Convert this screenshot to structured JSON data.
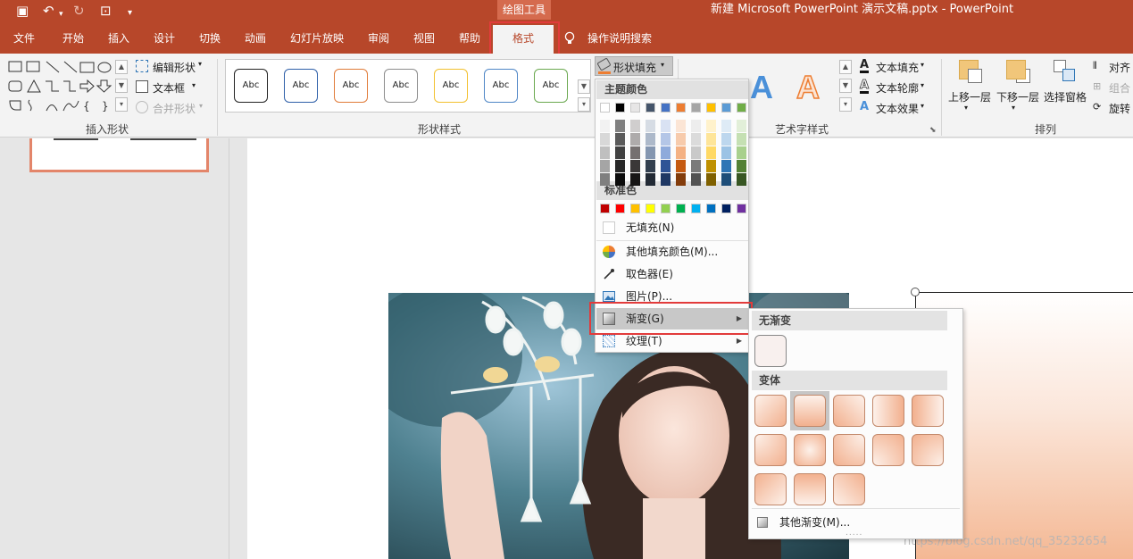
{
  "title_bar": {
    "context_tab_group": "绘图工具",
    "document_title": "新建 Microsoft PowerPoint 演示文稿.pptx  -  PowerPoint"
  },
  "tabs": [
    "文件",
    "开始",
    "插入",
    "设计",
    "切换",
    "动画",
    "幻灯片放映",
    "审阅",
    "视图",
    "帮助"
  ],
  "active_tab": "格式",
  "tell_me": "操作说明搜索",
  "ribbon": {
    "insert_shapes": {
      "label": "插入形状",
      "edit_shape": "编辑形状",
      "text_box": "文本框",
      "merge_shapes": "合并形状"
    },
    "shape_styles": {
      "label": "形状样式",
      "preset_text": "Abc",
      "shape_fill": "形状填充"
    },
    "wordart_styles": {
      "label": "艺术字样式",
      "text_fill": "文本填充",
      "text_outline": "文本轮廓",
      "text_effects": "文本效果",
      "letter": "A"
    },
    "arrange": {
      "label": "排列",
      "bring_forward": "上移一层",
      "send_backward": "下移一层",
      "selection_pane": "选择窗格",
      "align": "对齐",
      "group": "组合",
      "rotate": "旋转"
    }
  },
  "fill_menu": {
    "theme_colors_header": "主题颜色",
    "standard_colors_header": "标准色",
    "no_fill": "无填充(N)",
    "more_fill_colors": "其他填充颜色(M)...",
    "eyedropper": "取色器(E)",
    "picture": "图片(P)...",
    "gradient": "渐变(G)",
    "texture": "纹理(T)",
    "theme_top_row": [
      "#ffffff",
      "#000000",
      "#e7e6e6",
      "#44546a",
      "#4472c4",
      "#ed7d31",
      "#a5a5a5",
      "#ffc000",
      "#5b9bd5",
      "#70ad47"
    ],
    "theme_shades": [
      [
        "#f2f2f2",
        "#7f7f7f",
        "#d0cece",
        "#d6dce4",
        "#d9e2f3",
        "#fbe5d5",
        "#ededed",
        "#fff2cc",
        "#deebf6",
        "#e2efd9"
      ],
      [
        "#d8d8d8",
        "#595959",
        "#aeabab",
        "#adb9ca",
        "#b4c6e7",
        "#f7cbac",
        "#dbdbdb",
        "#fee599",
        "#bdd7ee",
        "#c5e0b3"
      ],
      [
        "#bfbfbf",
        "#3f3f3f",
        "#757070",
        "#8496b0",
        "#8eaadb",
        "#f4b183",
        "#c9c9c9",
        "#ffd965",
        "#9cc3e5",
        "#a8d08d"
      ],
      [
        "#a5a5a5",
        "#262626",
        "#3a3838",
        "#323f4f",
        "#2f5496",
        "#c55a11",
        "#7b7b7b",
        "#bf9000",
        "#2e75b5",
        "#538135"
      ],
      [
        "#7f7f7f",
        "#0c0c0c",
        "#171616",
        "#222a35",
        "#1f3864",
        "#833c0b",
        "#525252",
        "#7f6000",
        "#1e4e79",
        "#375623"
      ]
    ],
    "standard_colors": [
      "#c00000",
      "#ff0000",
      "#ffc000",
      "#ffff00",
      "#92d050",
      "#00b050",
      "#00b0f0",
      "#0070c0",
      "#002060",
      "#7030a0"
    ]
  },
  "gradient_submenu": {
    "no_gradient_header": "无渐变",
    "variants_header": "变体",
    "more_gradients": "其他渐变(M)..."
  },
  "watermark": "https://blog.csdn.net/qq_35232654",
  "colors": {
    "accent": "#b7472a",
    "highlight_box": "#e23b3b",
    "gradient_light": "#fdf1ea",
    "gradient_dark": "#f2b08e"
  }
}
